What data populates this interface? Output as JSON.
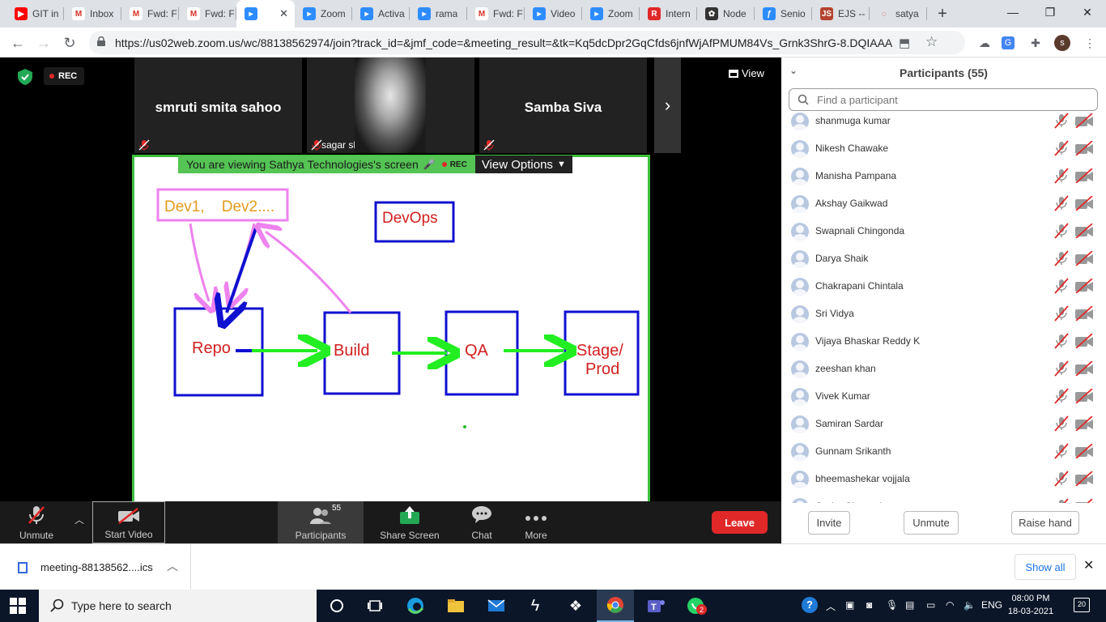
{
  "browser": {
    "tabs": [
      {
        "title": "GIT in",
        "fav_color": "#ff0000",
        "fav_glyph": "▶"
      },
      {
        "title": "Inbox",
        "fav_color": "#ffffff",
        "fav_glyph": "M"
      },
      {
        "title": "Fwd: F",
        "fav_color": "#ffffff",
        "fav_glyph": "M"
      },
      {
        "title": "Fwd: F",
        "fav_color": "#ffffff",
        "fav_glyph": "M"
      },
      {
        "title": "",
        "fav_color": "#2d8cff",
        "fav_glyph": "▸",
        "active": true
      },
      {
        "title": "Zoom",
        "fav_color": "#2d8cff",
        "fav_glyph": "▸"
      },
      {
        "title": "Activa",
        "fav_color": "#2d8cff",
        "fav_glyph": "▸"
      },
      {
        "title": "rama",
        "fav_color": "#2d8cff",
        "fav_glyph": "▸"
      },
      {
        "title": "Fwd: F",
        "fav_color": "#ffffff",
        "fav_glyph": "M"
      },
      {
        "title": "Video",
        "fav_color": "#2d8cff",
        "fav_glyph": "▸"
      },
      {
        "title": "Zoom",
        "fav_color": "#2d8cff",
        "fav_glyph": "▸"
      },
      {
        "title": "Intern",
        "fav_color": "#e02828",
        "fav_glyph": "R"
      },
      {
        "title": "Node",
        "fav_color": "#333333",
        "fav_glyph": "✿"
      },
      {
        "title": "Senio",
        "fav_color": "#2d8cff",
        "fav_glyph": "ƒ"
      },
      {
        "title": "EJS --",
        "fav_color": "#b5432e",
        "fav_glyph": "JS"
      },
      {
        "title": "satya",
        "fav_color": "#dee1e6",
        "fav_glyph": "◌"
      }
    ],
    "new_tab": "+",
    "window_controls": {
      "minimize": "—",
      "maximize": "❐",
      "close": "✕"
    },
    "url": "https://us02web.zoom.us/wc/88138562974/join?track_id=&jmf_code=&meeting_result=&tk=Kq5dcDpr2GqCfds6jnfWjAfPMUM84Vs_Grnk3ShrG-8.DQIAAAA...",
    "profile_initial": "s"
  },
  "zoom": {
    "rec_label": "REC",
    "tiles": [
      {
        "name": "smruti smita sahoo"
      },
      {
        "name": "sagar shukla"
      },
      {
        "name": "Samba Siva"
      }
    ],
    "view_label": "View",
    "share_banner": "You are viewing Sathya Technologies's screen",
    "view_options": "View Options",
    "whiteboard": {
      "dev_label": "Dev1,    Dev2....",
      "devops_label": "DevOps",
      "repo": "Repo",
      "build": "Build",
      "qa": "QA",
      "stage": "Stage/",
      "prod": "Prod"
    },
    "toolbar": {
      "unmute": "Unmute",
      "start_video": "Start Video",
      "participants": "Participants",
      "participants_count": "55",
      "share_screen": "Share Screen",
      "chat": "Chat",
      "more": "More",
      "leave": "Leave"
    }
  },
  "participants": {
    "title": "Participants (55)",
    "search_placeholder": "Find a participant",
    "list": [
      "shanmuga kumar",
      "Nikesh Chawake",
      "Manisha Pampana",
      "Akshay Gaikwad",
      "Swapnali Chingonda",
      "Darya Shaik",
      "Chakrapani Chintala",
      "Sri Vidya",
      "Vijaya Bhaskar Reddy K",
      "zeeshan khan",
      "Vivek Kumar",
      "Samiran Sardar",
      "Gunnam Srikanth",
      "bheemashekar vojjala",
      "Gudur Chaaurti"
    ],
    "invite": "Invite",
    "unmute": "Unmute",
    "raise_hand": "Raise hand"
  },
  "downloads": {
    "file": "meeting-88138562....ics",
    "show_all": "Show all"
  },
  "taskbar": {
    "search": "Type here to search",
    "lang": "ENG",
    "time": "08:00 PM",
    "date": "18-03-2021",
    "notifications": "20",
    "whatsapp_badge": "2"
  }
}
